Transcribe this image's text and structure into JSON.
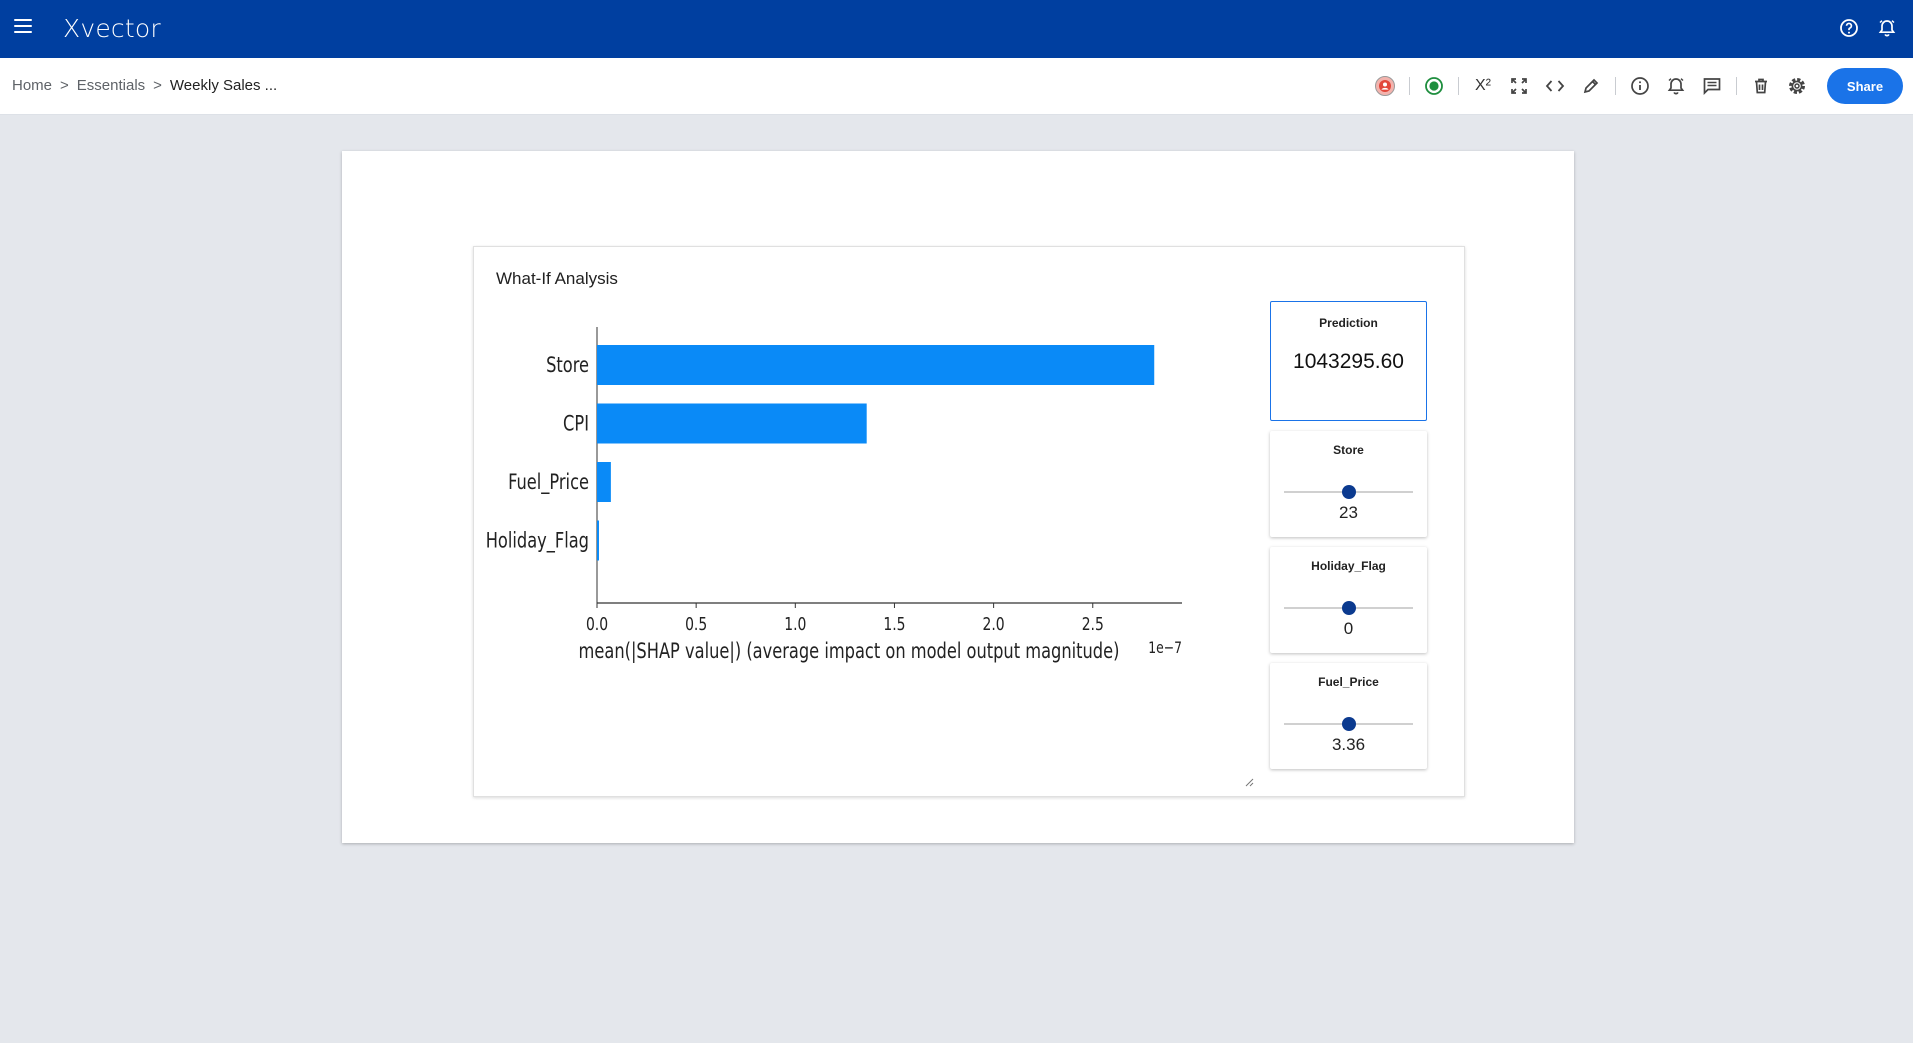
{
  "app": {
    "title": "Xvector"
  },
  "breadcrumb": {
    "home": "Home",
    "sep": ">",
    "section": "Essentials",
    "current": "Weekly Sales ..."
  },
  "toolbar": {
    "share_label": "Share",
    "superscript_label": "X²"
  },
  "colors": {
    "topbar": "#003fa0",
    "accent": "#1a73e8",
    "bar": "#0a8af7",
    "thumb": "#0b3a8f"
  },
  "card": {
    "title": "What-If Analysis"
  },
  "prediction": {
    "label": "Prediction",
    "value": "1043295.60"
  },
  "sliders": [
    {
      "name": "Store",
      "value": "23",
      "position": 0.5
    },
    {
      "name": "Holiday_Flag",
      "value": "0",
      "position": 0.5
    },
    {
      "name": "Fuel_Price",
      "value": "3.36",
      "position": 0.5
    }
  ],
  "chart_data": {
    "type": "bar",
    "orientation": "horizontal",
    "categories": [
      "Store",
      "CPI",
      "Fuel_Price",
      "Holiday_Flag"
    ],
    "values": [
      2.81,
      1.36,
      0.07,
      0.01
    ],
    "xlabel": "mean(|SHAP value|) (average impact on model output magnitude)",
    "offset_label": "1e−7",
    "xticks": [
      "0.0",
      "0.5",
      "1.0",
      "1.5",
      "2.0",
      "2.5"
    ],
    "xtick_values": [
      0,
      0.5,
      1.0,
      1.5,
      2.0,
      2.5
    ],
    "xlim": [
      0,
      2.95
    ],
    "grid": false
  }
}
